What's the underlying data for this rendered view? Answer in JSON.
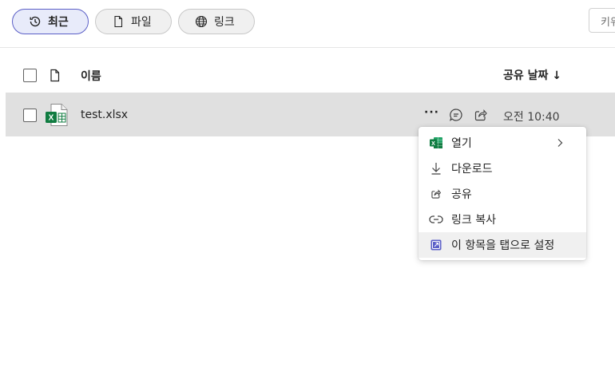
{
  "filters": {
    "recent_label": "최근",
    "files_label": "파일",
    "links_label": "링크",
    "search_placeholder": "키워드로 필터링"
  },
  "table": {
    "name_header": "이름",
    "shared_date_header": "공유 날짜",
    "sort_arrow": "↓",
    "rows": [
      {
        "name": "test.xlsx",
        "shared_date": "오전 10:40",
        "file_type": "excel-file-icon"
      }
    ],
    "more_label": "···"
  },
  "context_menu": {
    "items": [
      {
        "label": "열기",
        "icon": "excel-icon",
        "has_submenu": true
      },
      {
        "label": "다운로드",
        "icon": "download-icon"
      },
      {
        "label": "공유",
        "icon": "share-icon"
      },
      {
        "label": "링크 복사",
        "icon": "link-icon"
      },
      {
        "label": "이 항목을 탭으로 설정",
        "icon": "open-as-tab-icon"
      }
    ]
  },
  "colors": {
    "accent": "#5b5fc7",
    "excel_green": "#107c41",
    "row_selected": "#e0e0e0"
  }
}
